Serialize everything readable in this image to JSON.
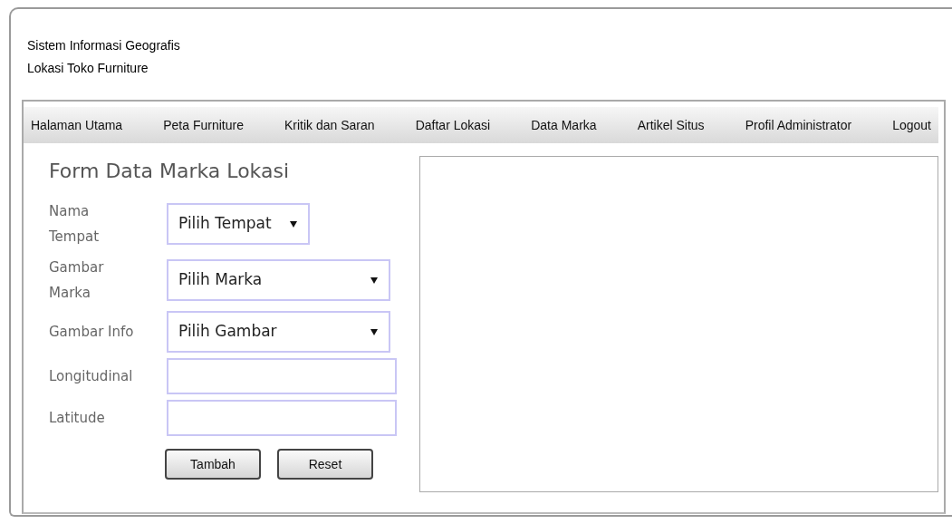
{
  "header": {
    "title_lines": [
      "Sistem Informasi Geografis",
      "Lokasi Toko Furniture"
    ]
  },
  "nav": {
    "items": [
      {
        "label": "Halaman Utama"
      },
      {
        "label": "Peta Furniture"
      },
      {
        "label": "Kritik dan Saran"
      },
      {
        "label": "Daftar Lokasi"
      },
      {
        "label": "Data Marka"
      },
      {
        "label": "Artikel Situs"
      },
      {
        "label": "Profil Administrator"
      },
      {
        "label": "Logout"
      }
    ]
  },
  "form": {
    "title": "Form Data Marka Lokasi",
    "fields": [
      {
        "label": "Nama Tempat",
        "kind": "short-select",
        "value": "Pilih Tempat"
      },
      {
        "label": "Gambar Marka",
        "kind": "select",
        "value": "Pilih Marka"
      },
      {
        "label": "Gambar Info",
        "kind": "select",
        "value": "Pilih Gambar"
      },
      {
        "label": "Longitudinal",
        "kind": "text"
      },
      {
        "label": "Latitude",
        "kind": "text"
      }
    ],
    "buttons": [
      "Tambah",
      "Reset"
    ]
  }
}
